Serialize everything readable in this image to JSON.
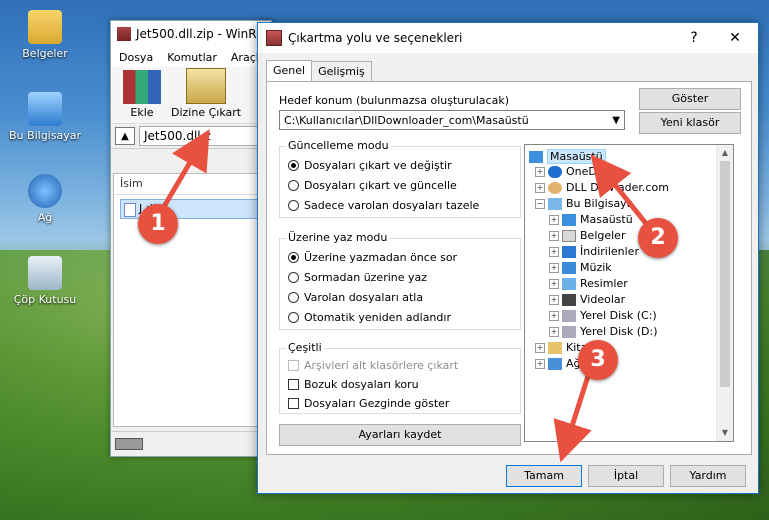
{
  "desktop": {
    "icons": [
      {
        "label": "Belgeler",
        "icon": "folder-icon"
      },
      {
        "label": "Bu Bilgisayar",
        "icon": "computer-icon"
      },
      {
        "label": "Ağ",
        "icon": "network-icon"
      },
      {
        "label": "Çöp Kutusu",
        "icon": "recycle-bin-icon"
      }
    ]
  },
  "winrar": {
    "title": "Jet500.dll.zip - WinR",
    "menu": [
      "Dosya",
      "Komutlar",
      "Araçla"
    ],
    "toolbar": {
      "add_label": "Ekle",
      "extract_label": "Dizine Çıkart"
    },
    "path": "Jet500.dll.z",
    "list_header": "İsim",
    "file_row": "J            dll"
  },
  "dialog": {
    "title": "Çıkartma yolu ve seçenekleri",
    "help_glyph": "?",
    "close_glyph": "✕",
    "tabs": [
      "Genel",
      "Gelişmiş"
    ],
    "dest_label": "Hedef konum (bulunmazsa oluşturulacak)",
    "dest_value": "C:\\Kullanıcılar\\DllDownloader_com\\Masaüstü",
    "show_button": "Göster",
    "new_folder_button": "Yeni klasör",
    "update_group": {
      "title": "Güncelleme modu",
      "options": [
        "Dosyaları çıkart ve değiştir",
        "Dosyaları çıkart ve güncelle",
        "Sadece varolan dosyaları tazele"
      ],
      "selected": 0
    },
    "overwrite_group": {
      "title": "Üzerine yaz modu",
      "options": [
        "Üzerine yazmadan önce sor",
        "Sormadan üzerine yaz",
        "Varolan dosyaları atla",
        "Otomatik yeniden adlandır"
      ],
      "selected": 0
    },
    "misc_group": {
      "title": "Çeşitli",
      "options": [
        "Arşivleri alt klasörlere çıkart",
        "Bozuk dosyaları koru",
        "Dosyaları Gezginde göster"
      ]
    },
    "save_settings_button": "Ayarları kaydet",
    "tree": {
      "root": "Masaüstü",
      "items": [
        "OneDr",
        "DLL Dow   ader.com",
        "Bu Bilgisaya",
        "Masaüstü",
        "Belgeler",
        "İndirilenler",
        "Müzik",
        "Resimler",
        "Videolar",
        "Yerel Disk (C:)",
        "Yerel Disk (D:)",
        "Kita",
        "Ağ"
      ]
    },
    "ok_button": "Tamam",
    "cancel_button": "İptal",
    "help_button": "Yardım"
  },
  "annotations": [
    "1",
    "2",
    "3"
  ],
  "colors": {
    "badge": "#e8503f",
    "selection": "#cce8ff",
    "accent": "#0078d7"
  }
}
